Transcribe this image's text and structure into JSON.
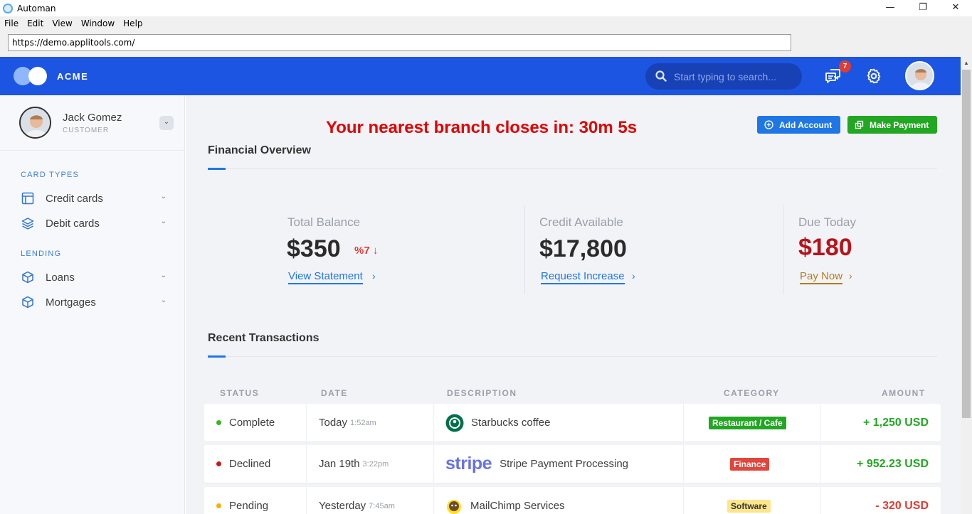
{
  "window": {
    "title": "Automan",
    "controls": {
      "minimize": "—",
      "maximize": "❐",
      "close": "✕"
    }
  },
  "menu": [
    "File",
    "Edit",
    "View",
    "Window",
    "Help"
  ],
  "address_bar": {
    "url": "https://demo.applitools.com/"
  },
  "header": {
    "brand": "ACME",
    "search_placeholder": "Start typing to search...",
    "notification_count": "7"
  },
  "profile": {
    "name": "Jack Gomez",
    "role": "CUSTOMER"
  },
  "sidebar": {
    "sections": [
      {
        "label": "CARD TYPES",
        "items": [
          {
            "label": "Credit cards",
            "icon": "credit-card-icon"
          },
          {
            "label": "Debit cards",
            "icon": "layers-icon"
          }
        ]
      },
      {
        "label": "LENDING",
        "items": [
          {
            "label": "Loans",
            "icon": "box-icon"
          },
          {
            "label": "Mortgages",
            "icon": "box-icon"
          }
        ]
      }
    ]
  },
  "main": {
    "countdown": "Your nearest branch closes in: 30m 5s",
    "buttons": {
      "add_account": "Add Account",
      "make_payment": "Make Payment"
    },
    "financial_overview": {
      "title": "Financial Overview",
      "stats": [
        {
          "label": "Total Balance",
          "value": "$350",
          "delta": "%7",
          "link": "View Statement"
        },
        {
          "label": "Credit Available",
          "value": "$17,800",
          "link": "Request Increase"
        },
        {
          "label": "Due Today",
          "value": "$180",
          "link": "Pay Now"
        }
      ]
    },
    "recent_transactions": {
      "title": "Recent Transactions",
      "columns": [
        "STATUS",
        "DATE",
        "DESCRIPTION",
        "CATEGORY",
        "AMOUNT"
      ],
      "rows": [
        {
          "status": "Complete",
          "status_color": "#3cb521",
          "date": "Today",
          "time": "1:52am",
          "logo": "starbucks-logo",
          "description": "Starbucks coffee",
          "category": "Restaurant / Cafe",
          "category_bg": "#22a722",
          "category_fg": "#ffffff",
          "amount": "+ 1,250 USD",
          "amount_color": "#22a722"
        },
        {
          "status": "Declined",
          "status_color": "#c21d1d",
          "date": "Jan 19th",
          "time": "3:22pm",
          "logo": "stripe-logo",
          "logo_text": "stripe",
          "description": "Stripe Payment Processing",
          "category": "Finance",
          "category_bg": "#e2453c",
          "category_fg": "#ffffff",
          "amount": "+ 952.23 USD",
          "amount_color": "#22a722"
        },
        {
          "status": "Pending",
          "status_color": "#f4b400",
          "date": "Yesterday",
          "time": "7:45am",
          "logo": "mailchimp-logo",
          "description": "MailChimp Services",
          "category": "Software",
          "category_bg": "#fde58a",
          "category_fg": "#333333",
          "amount": "- 320 USD",
          "amount_color": "#e03c31"
        }
      ]
    }
  }
}
